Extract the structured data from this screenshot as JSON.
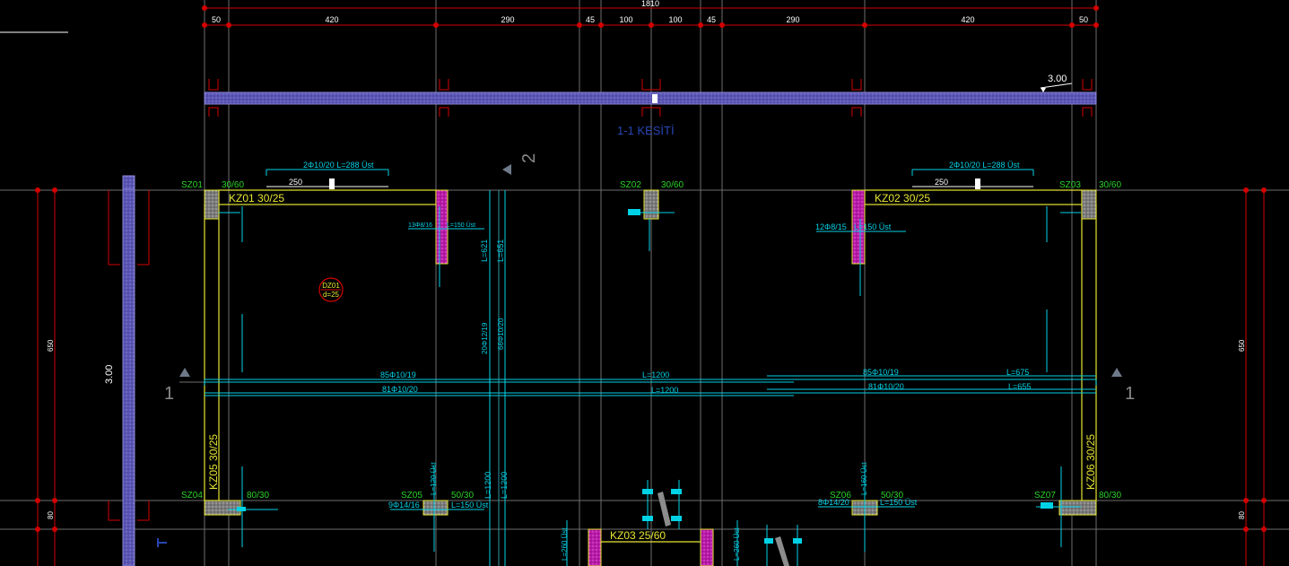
{
  "colors": {
    "background": "#000000",
    "grid": "#6e6e6e",
    "dim_red": "#d40000",
    "beam_blue": "#5a55b4",
    "column_gray": "#8c8c8c",
    "column_magenta": "#d21ec8",
    "beam_yellow": "#e6e632",
    "rebar_cyan": "#00d2e6",
    "label_green": "#2ad22a",
    "text_white": "#ffffff",
    "section_blue": "#2846b4"
  },
  "dimensions": {
    "total": "1810",
    "segments": [
      "50",
      "420",
      "290",
      "45",
      "100",
      "100",
      "45",
      "290",
      "420",
      "50"
    ],
    "left_height": "650",
    "left_low": "80",
    "right_height": "650",
    "right_low": "80"
  },
  "elevation": {
    "top": "3.00",
    "side": "3.00"
  },
  "section": {
    "title": "1-1 KESİTİ",
    "marker1": "1",
    "marker2": "2"
  },
  "columns": {
    "sz01": {
      "name": "SZ01",
      "size": "30/60"
    },
    "sz02": {
      "name": "SZ02",
      "size": "30/60"
    },
    "sz03": {
      "name": "SZ03",
      "size": "30/60"
    },
    "sz04": {
      "name": "SZ04",
      "size": "80/30"
    },
    "sz05": {
      "name": "SZ05",
      "size": "50/30"
    },
    "sz06": {
      "name": "SZ06",
      "size": "50/30"
    },
    "sz07": {
      "name": "SZ07",
      "size": "80/30"
    }
  },
  "beams": {
    "kz01": "KZ01 30/25",
    "kz02": "KZ02 30/25",
    "kz03": "KZ03 25/60",
    "kz05": "KZ05 30/25",
    "kz06": "KZ06 30/25"
  },
  "slab": {
    "name": "DZ01",
    "thickness": "d=25"
  },
  "rebar": {
    "top_left": "2Φ10/20   L=288 Üst",
    "top_left_len": "250",
    "top_right": "2Φ10/20   L=288 Üst",
    "top_right_len": "250",
    "small_30": "30",
    "mid_left": "13Φ8/16",
    "mid_left_len": "L=150 Üst",
    "mid_right": "12Φ8/15",
    "mid_right_len": "L=150 Üst",
    "long1_left": "85Φ10/19",
    "long1_mid": "L=1200",
    "long1_right": "85Φ10/19",
    "long1_rlen": "L=675",
    "long2_left": "81Φ10/20",
    "long2_mid": "L=1200",
    "long2_right": "81Φ10/20",
    "long2_rlen": "L=655",
    "bot_sz05": "9Φ14/16",
    "bot_sz05_len": "L=150 Üst",
    "bot_sz06": "8Φ14/20",
    "bot_sz06_len": "L=150 Üst",
    "v_l621": "L=621",
    "v_l651": "L=651",
    "v_l1200a": "L=1200",
    "v_l1200b": "L=1200",
    "v_l120": "L=120 Üst",
    "v_l160": "L=160 Üst",
    "v_l260a": "L=260 Üst",
    "v_l260b": "L=260 Üst",
    "v_9012": "20Φ12/19",
    "v_6010": "66Φ10/20"
  }
}
